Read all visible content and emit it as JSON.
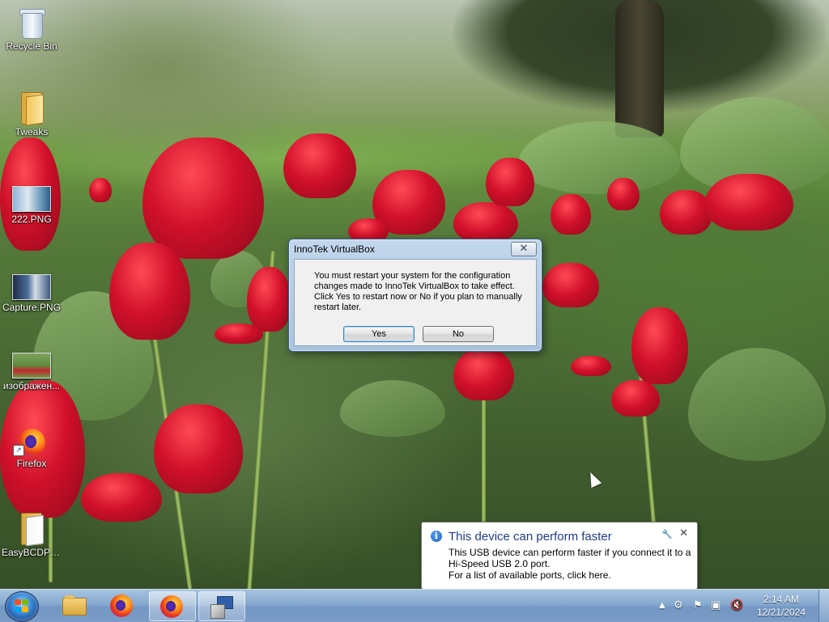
{
  "desktop": {
    "icons": [
      {
        "label": "Recycle Bin",
        "icon": "recycle-bin-icon"
      },
      {
        "label": "Tweaks",
        "icon": "folder-icon"
      },
      {
        "label": "222.PNG",
        "icon": "image-thumbnail-icon"
      },
      {
        "label": "Capture.PNG",
        "icon": "image-thumbnail-icon"
      },
      {
        "label": "изображен...",
        "icon": "image-thumbnail-icon"
      },
      {
        "label": "Firefox",
        "icon": "firefox-icon"
      },
      {
        "label": "EasyBCDPor...",
        "icon": "folder-icon"
      }
    ]
  },
  "dialog": {
    "title": "InnoTek VirtualBox",
    "message": "You must restart your system for the configuration changes made to InnoTek VirtualBox to take effect. Click Yes to restart now or No if you plan to manually restart later.",
    "yes_label": "Yes",
    "no_label": "No",
    "close_glyph": "✕"
  },
  "notification": {
    "title": "This device can perform faster",
    "line1": "This USB device can perform faster if you connect it to a",
    "line2": "Hi-Speed USB 2.0 port.",
    "line3": "For a list of available ports, click here.",
    "close_glyph": "✕"
  },
  "taskbar": {
    "pinned": [
      "windows-explorer-icon",
      "firefox-icon",
      "firefox-icon",
      "setup-installer-icon"
    ],
    "time": "2:14 AM",
    "date": "12/21/2024"
  },
  "colors": {
    "taskbar": "#86a9cf",
    "dialog_frame": "#a9c3de",
    "notification_title": "#1f3c88",
    "tulip_red": "#d1102a"
  }
}
